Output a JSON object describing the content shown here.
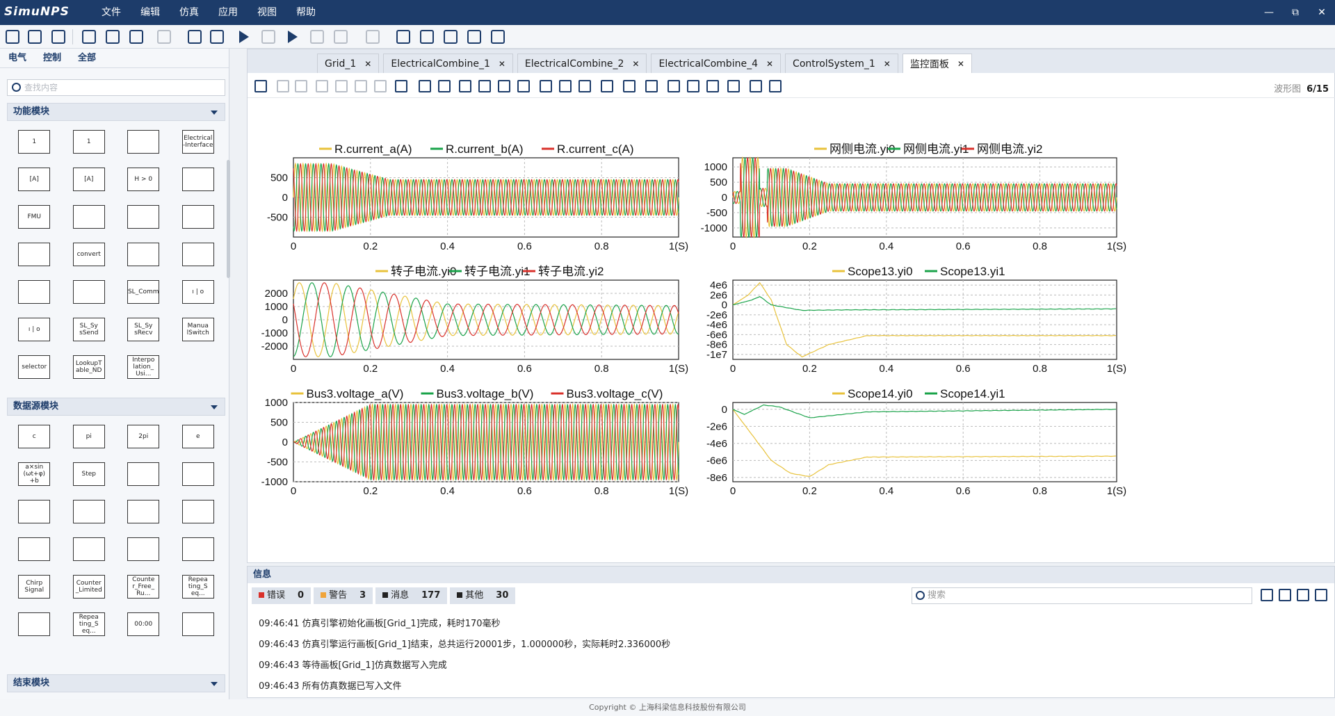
{
  "app": {
    "logo": "SimuNPS",
    "menu": [
      "文件",
      "编辑",
      "仿真",
      "应用",
      "视图",
      "帮助"
    ],
    "window_controls": [
      "—",
      "⧉",
      "✕"
    ]
  },
  "left": {
    "tabs": [
      "电气",
      "控制",
      "全部"
    ],
    "search_placeholder": "查找内容",
    "sections": [
      {
        "title": "功能模块",
        "blocks": [
          "1",
          "1",
          "",
          "Electrical -Interface",
          "[A]",
          "[A]",
          "H > 0",
          "",
          "FMU",
          "",
          "",
          "",
          "",
          "convert",
          "",
          "",
          "",
          "",
          "SL_Comm",
          "ı | o",
          "ı | o",
          "SL_Sy sSend",
          "SL_Sy sRecv",
          "Manua lSwitch",
          "selector",
          "LookupT able_ND",
          "Interpo lation_ Usi..."
        ]
      },
      {
        "title": "数据源模块",
        "blocks": [
          "c",
          "pi",
          "2pi",
          "e",
          "a×sin (ωt+φ) +b",
          "Step",
          "",
          "",
          "",
          "",
          "",
          "",
          "",
          "",
          "",
          "",
          "Chirp Signal",
          "Counter _Limited",
          "Counte r_Free_ Ru...",
          "Repea ting_S eq...",
          "",
          "Repea ting_S eq...",
          "00:00",
          ""
        ]
      },
      {
        "title": "结束模块"
      }
    ]
  },
  "tabs": [
    {
      "label": "Grid_1"
    },
    {
      "label": "ElectricalCombine_1"
    },
    {
      "label": "ElectricalCombine_2"
    },
    {
      "label": "ElectricalCombine_4"
    },
    {
      "label": "ControlSystem_1"
    },
    {
      "label": "监控面板"
    }
  ],
  "panel": {
    "wave_label": "波形图",
    "wave_count": "6/15"
  },
  "colors": {
    "yellow": "#e8c23b",
    "green": "#1aa34a",
    "red": "#d9312b"
  },
  "info": {
    "title": "信息",
    "search_placeholder": "搜索",
    "badges": [
      {
        "label": "错误",
        "count": "0",
        "color": "#d9312b"
      },
      {
        "label": "警告",
        "count": "3",
        "color": "#f0a43a"
      },
      {
        "label": "消息",
        "count": "177",
        "color": "#222222"
      },
      {
        "label": "其他",
        "count": "30",
        "color": "#222222"
      }
    ],
    "messages": [
      "09:46:41 仿真引擎初始化画板[Grid_1]完成，耗时170毫秒",
      "09:46:43 仿真引擎运行画板[Grid_1]结束，总共运行20001步，1.000000秒，实际耗时2.336000秒",
      "09:46:43 等待画板[Grid_1]仿真数据写入完成",
      "09:46:43 所有仿真数据已写入文件"
    ]
  },
  "footer": "Copyright © 上海科梁信息科技股份有限公司",
  "chart_data": [
    {
      "type": "line",
      "title": "",
      "legend": [
        "R.current_a(A)",
        "R.current_b(A)",
        "R.current_c(A)"
      ],
      "x_ticks": [
        "0",
        "0.2",
        "0.4",
        "0.6",
        "0.8",
        "1(S)"
      ],
      "y_ticks": [
        "500",
        "0",
        "-500"
      ],
      "ylim": [
        -1000,
        1000
      ],
      "desc": "three-phase oscillation, peak ~850 decaying to ~450 by 0.25s"
    },
    {
      "type": "line",
      "title": "",
      "legend": [
        "网侧电流.yi0",
        "网侧电流.yi1",
        "网侧电流.yi2"
      ],
      "x_ticks": [
        "0",
        "0.2",
        "0.4",
        "0.6",
        "0.8",
        "1(S)"
      ],
      "y_ticks": [
        "1000",
        "500",
        "0",
        "-500",
        "-1000"
      ],
      "ylim": [
        -1300,
        1300
      ],
      "desc": "transient up to ~1300 near 0.06s, settles ~450 amplitude"
    },
    {
      "type": "line",
      "title": "",
      "legend": [
        "转子电流.yi0",
        "转子电流.yi1",
        "转子电流.yi2"
      ],
      "x_ticks": [
        "0",
        "0.2",
        "0.4",
        "0.6",
        "0.8",
        "1(S)"
      ],
      "y_ticks": [
        "2000",
        "1000",
        "0",
        "-1000",
        "-2000"
      ],
      "ylim": [
        -3000,
        3000
      ],
      "desc": "low-frequency three-phase, amplitude ~2800 decaying to ~1000"
    },
    {
      "type": "line",
      "title": "",
      "legend": [
        "Scope13.yi0",
        "Scope13.yi1"
      ],
      "x_ticks": [
        "0",
        "0.2",
        "0.4",
        "0.6",
        "0.8",
        "1(S)"
      ],
      "y_ticks": [
        "4e6",
        "2e6",
        "0",
        "-2e6",
        "-4e6",
        "-6e6",
        "-8e6",
        "-1e7"
      ],
      "ylim": [
        -11000000.0,
        5000000.0
      ],
      "series": [
        {
          "name": "Scope13.yi0",
          "points": [
            [
              0,
              0
            ],
            [
              0.04,
              2000000.0
            ],
            [
              0.07,
              4500000.0
            ],
            [
              0.1,
              1000000.0
            ],
            [
              0.14,
              -8000000.0
            ],
            [
              0.18,
              -10500000.0
            ],
            [
              0.25,
              -8000000.0
            ],
            [
              0.35,
              -6200000.0
            ],
            [
              1,
              -6200000.0
            ]
          ]
        },
        {
          "name": "Scope13.yi1",
          "points": [
            [
              0,
              0
            ],
            [
              0.05,
              1000000.0
            ],
            [
              0.07,
              1700000.0
            ],
            [
              0.1,
              0
            ],
            [
              0.18,
              -1100000.0
            ],
            [
              0.3,
              -1000000.0
            ],
            [
              1,
              -800000.0
            ]
          ]
        }
      ]
    },
    {
      "type": "line",
      "title": "",
      "legend": [
        "Bus3.voltage_a(V)",
        "Bus3.voltage_b(V)",
        "Bus3.voltage_c(V)"
      ],
      "x_ticks": [
        "0",
        "0.2",
        "0.4",
        "0.6",
        "0.8",
        "1(S)"
      ],
      "y_ticks": [
        "1000",
        "500",
        "0",
        "-500",
        "-1000"
      ],
      "ylim": [
        -1000,
        1000
      ],
      "desc": "three-phase voltage ramping from 0 to ~950 by 0.2s"
    },
    {
      "type": "line",
      "title": "",
      "legend": [
        "Scope14.yi0",
        "Scope14.yi1"
      ],
      "x_ticks": [
        "0",
        "0.2",
        "0.4",
        "0.6",
        "0.8",
        "1(S)"
      ],
      "y_ticks": [
        "0",
        "-2e6",
        "-4e6",
        "-6e6",
        "-8e6"
      ],
      "ylim": [
        -8500000.0,
        800000.0
      ],
      "series": [
        {
          "name": "Scope14.yi0",
          "points": [
            [
              0,
              0
            ],
            [
              0.05,
              -3000000.0
            ],
            [
              0.1,
              -6000000.0
            ],
            [
              0.15,
              -7500000.0
            ],
            [
              0.2,
              -7900000.0
            ],
            [
              0.25,
              -6500000.0
            ],
            [
              0.35,
              -5600000.0
            ],
            [
              1,
              -5500000.0
            ]
          ]
        },
        {
          "name": "Scope14.yi1",
          "points": [
            [
              0,
              0
            ],
            [
              0.03,
              -600000.0
            ],
            [
              0.08,
              500000.0
            ],
            [
              0.12,
              300000.0
            ],
            [
              0.2,
              -1000000.0
            ],
            [
              0.35,
              -300000.0
            ],
            [
              1,
              0
            ]
          ]
        }
      ]
    }
  ]
}
